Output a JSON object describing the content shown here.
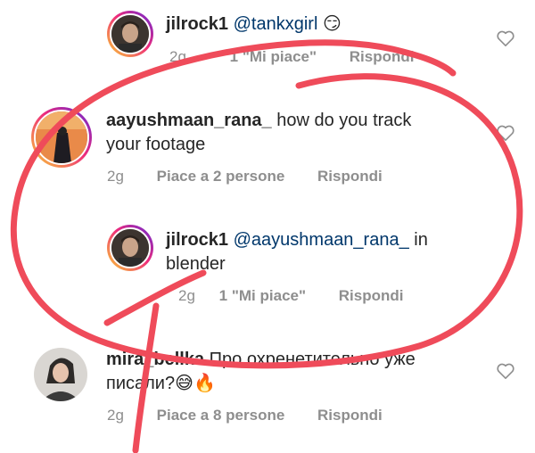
{
  "comments": [
    {
      "username": "jilrock1",
      "mention": "@tankxgirl",
      "emoji": "😏",
      "time": "2g",
      "likes": "1 \"Mi piace\"",
      "reply": "Rispondi"
    },
    {
      "username": "aayushmaan_rana_",
      "text_line1": "how do you track",
      "text_line2": "your footage",
      "time": "2g",
      "likes": "Piace a 2 persone",
      "reply": "Rispondi"
    },
    {
      "username": "jilrock1",
      "mention": "@aayushmaan_rana_",
      "text_line1_suffix": "in",
      "text_line2": "blender",
      "time": "2g",
      "likes": "1 \"Mi piace\"",
      "reply": "Rispondi"
    },
    {
      "username": "mira_bellka",
      "text_line1": "Про охренетительно уже",
      "text_line2": "писали?",
      "emoji": "😅🔥",
      "time": "2g",
      "likes": "Piace a 8 persone",
      "reply": "Rispondi"
    }
  ],
  "icons": {
    "heart": "heart-outline-icon"
  },
  "colors": {
    "annotation_red": "#ef4b5a",
    "mention_blue": "#00376b",
    "meta_gray": "#8e8e8e"
  }
}
